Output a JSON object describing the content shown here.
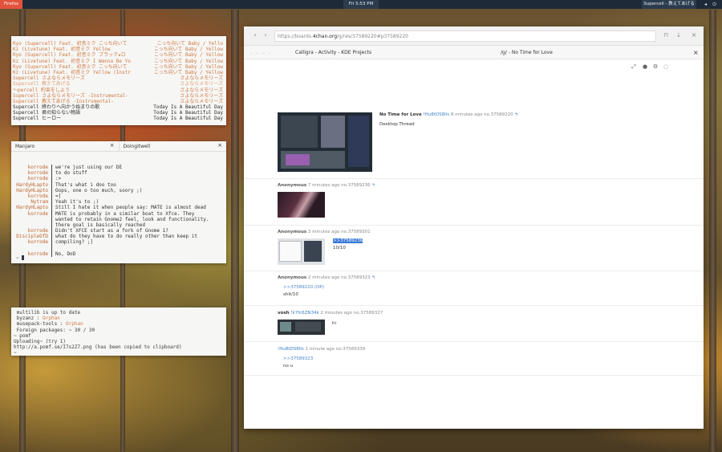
{
  "topbar": {
    "app": "Firefox",
    "clock": "Fri 5:53 PM",
    "now_playing": "Supercell - 教えてあげる"
  },
  "music_term": {
    "rows": [
      {
        "left": "Ryo (Supercell) Feat. 初音ミク こっち向いて",
        "right": "こっち向いて Baby / Yello",
        "color": "orange"
      },
      {
        "left": "Kz (Livetune) Feat. 初音ミク Yellow",
        "right": "こっち向いて Baby / Yellow",
        "color": "orange"
      },
      {
        "left": "Ryo (Supercell) Feat. 初音ミク ブラック★ロ",
        "right": "こっち向いて Baby / Yellow",
        "color": "orange"
      },
      {
        "left": "Kz (Livetune) Feat. 初音ミク I Wanna Be Yo",
        "right": "こっち向いて Baby / Yellow",
        "color": "orange"
      },
      {
        "left": "Ryo (Supercell) Feat. 初音ミク こっち向いて",
        "right": "こっち向いて Baby / Yellow",
        "color": "orange"
      },
      {
        "left": "Kz (Livetune) Feat. 初音ミク Yellow (Instr",
        "right": "こっち向いて Baby / Yellow",
        "color": "orange"
      },
      {
        "left": "Supercell さよならメモリーズ",
        "right": "さよならメモリーズ",
        "color": "orange"
      },
      {
        "left": "Supercell 教えてあげる",
        "right": "さよならメモリーズ",
        "color": "peach"
      },
      {
        "left": "〜percell 約束をしよう",
        "right": "さよならメモリーズ",
        "color": "orange"
      },
      {
        "left": "Supercell さよならメモリーズ -Instrumental-",
        "right": "さよならメモリーズ",
        "color": "orange"
      },
      {
        "left": "Supercell 教えてあげる -Instrumental-",
        "right": "さよならメモリーズ",
        "color": "orange"
      },
      {
        "left": "Supercell 終わりへ向かう始まりの歌",
        "right": "Today Is A Beautiful Day",
        "color": "dark"
      },
      {
        "left": "Supercell 君の知らない物語",
        "right": "Today Is A Beautiful Day",
        "color": "dark"
      },
      {
        "left": "Supercell ヒーロー",
        "right": "Today Is A Beautiful Day",
        "color": "dark"
      }
    ]
  },
  "chat_term": {
    "tabs": [
      {
        "label": "Manjaro"
      },
      {
        "label": "Doingitwell"
      }
    ],
    "close_glyph": "×",
    "lines": [
      {
        "nick": "korrode",
        "msg": "we're just using our DE"
      },
      {
        "nick": "korrode",
        "msg": "to do stuff"
      },
      {
        "nick": "korrode",
        "msg": ":>"
      },
      {
        "nick": "HardyHLapto",
        "msg": "That's what i doo too"
      },
      {
        "nick": "HardyHLapto",
        "msg": "Oops, one o too much, soory ;)"
      },
      {
        "nick": "korrode",
        "msg": "=]"
      },
      {
        "nick": "Nytram",
        "msg": "Yeah it's to ;)"
      },
      {
        "nick": "HardyHLapto",
        "msg": "Still I hate it when people say: MATE is almost dead"
      },
      {
        "nick": "korrode",
        "msg": "MATE is probably in a similar boat to Xfce. They"
      },
      {
        "nick": "",
        "msg": "wanted to retain Gnome2 feel, look and functionality."
      },
      {
        "nick": "",
        "msg": "there goal is basically reached"
      },
      {
        "nick": "korrode",
        "msg": "Didn't XFCE start as a fork of Gnome 1?"
      },
      {
        "nick": "DiscipleOfD",
        "msg": "what do they have to do really other than keep it"
      },
      {
        "nick": "korrode",
        "msg": "compiling? ;]"
      },
      {
        "nick": "",
        "msg": ""
      },
      {
        "nick": "korrode",
        "msg": "No, DoD"
      }
    ],
    "prompt": "~"
  },
  "pkg_term": {
    "lines": [
      {
        "a": " multilib is up to date",
        "b": ""
      },
      {
        "a": " byzanz : ",
        "b": "Orphan"
      },
      {
        "a": " musepack-tools : ",
        "b": "Orphan"
      },
      {
        "a": " Foreign packages: ~ 30 / 30",
        "b": ""
      },
      {
        "a": "~ pomf",
        "b": ""
      },
      {
        "a": "Uploading~ (try 1)",
        "b": ""
      },
      {
        "a": "http://a.pomf.se/I7s2Z7.png (has been copied to clipboard)",
        "b": ""
      },
      {
        "a": "~",
        "b": ""
      }
    ]
  },
  "browser": {
    "url_prefix": "https://boards.",
    "url_host": "4chan.org",
    "url_path": "/g/res/37589220#p37589220",
    "tabs": [
      {
        "label": "Calligra - Activity - KDE Projects"
      },
      {
        "label": "/g/ - No Time for Love"
      }
    ],
    "tab_close": "×",
    "dots": "....",
    "posts": [
      {
        "name": "No Time for Love",
        "trip": "!Hu8tDS8lls",
        "meta": "8 minutes ago no.37589220",
        "body": "Desktop Thread",
        "quote": ""
      },
      {
        "name": "Anonymous",
        "trip": "",
        "meta": "7 minutes ago no.37589236",
        "body": "",
        "quote": ""
      },
      {
        "name": "Anonymous",
        "trip": "",
        "meta": "3 minutes ago no.37589301",
        "body": "10/10",
        "quote": ">>37589236"
      },
      {
        "name": "Anonymous",
        "trip": "",
        "meta": "2 minutes ago no.37589323",
        "body": "shit/10",
        "quote": ">>37589220 (OP)"
      },
      {
        "name": "vosh",
        "trip": "!k7fc6ZN34k",
        "meta": "2 minutes ago no.37589327",
        "body": "hi",
        "quote": ""
      },
      {
        "name": "",
        "trip": "!Hu8tDS8lls",
        "meta": "1 minute ago no.37589339",
        "body": "no u",
        "quote": ">>37589323"
      }
    ]
  },
  "colors": {
    "accent": "#3c7fc9",
    "orange": "#d07a44",
    "firefox": "#e2523c"
  }
}
